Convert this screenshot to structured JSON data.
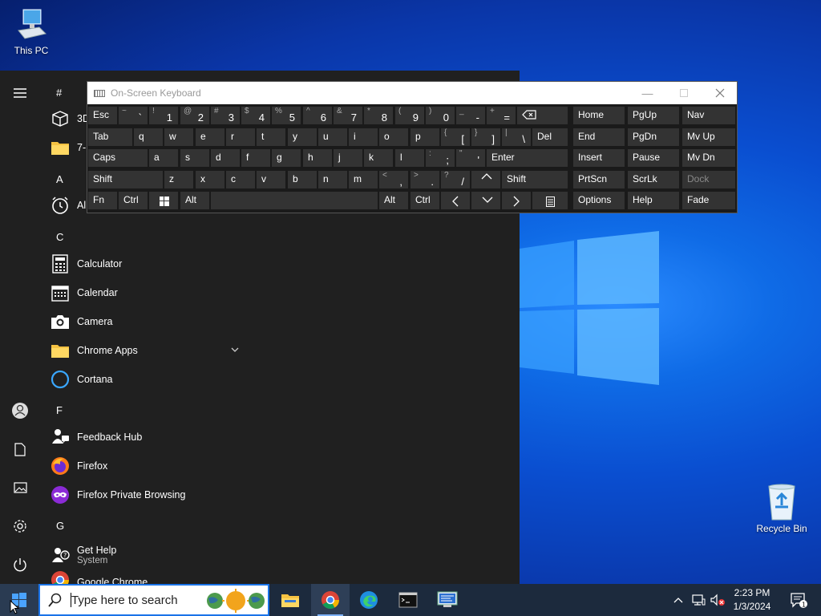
{
  "desktop": {
    "icons": [
      {
        "label": "This PC",
        "icon": "this-pc-icon"
      },
      {
        "label": "Recycle Bin",
        "icon": "recycle-bin-icon"
      }
    ]
  },
  "start_menu": {
    "rail": [
      "hamburger-icon",
      "user-icon",
      "documents-icon",
      "pictures-icon",
      "settings-icon",
      "power-icon"
    ],
    "letters": {
      "hash": "#",
      "a": "A",
      "c": "C",
      "f": "F",
      "g": "G"
    },
    "apps": {
      "3d": "3D",
      "sevenzip": "7-",
      "alarms": "Al",
      "calculator": "Calculator",
      "calendar": "Calendar",
      "camera": "Camera",
      "chrome_apps": "Chrome Apps",
      "cortana": "Cortana",
      "feedback_hub": "Feedback Hub",
      "firefox": "Firefox",
      "firefox_private": "Firefox Private Browsing",
      "get_help": "Get Help",
      "get_help_sub": "System",
      "google_chrome": "Google Chrome"
    }
  },
  "osk": {
    "title": "On-Screen Keyboard",
    "row1": [
      {
        "main": "Esc"
      },
      {
        "shift": "~",
        "low": "`",
        "sh2": "`"
      },
      {
        "shift": "!",
        "low": "1"
      },
      {
        "shift": "@",
        "low": "2"
      },
      {
        "shift": "#",
        "low": "3"
      },
      {
        "shift": "$",
        "low": "4"
      },
      {
        "shift": "%",
        "low": "5"
      },
      {
        "shift": "^",
        "low": "6"
      },
      {
        "shift": "&",
        "low": "7"
      },
      {
        "shift": "*",
        "low": "8"
      },
      {
        "shift": "(",
        "low": "9"
      },
      {
        "shift": ")",
        "low": "0"
      },
      {
        "shift": "_",
        "low": "-"
      },
      {
        "shift": "+",
        "low": "="
      },
      {
        "main": "⌫"
      }
    ],
    "row2": [
      {
        "main": "Tab"
      },
      {
        "main": "q"
      },
      {
        "main": "w"
      },
      {
        "main": "e"
      },
      {
        "main": "r"
      },
      {
        "main": "t"
      },
      {
        "main": "y"
      },
      {
        "main": "u"
      },
      {
        "main": "i"
      },
      {
        "main": "o"
      },
      {
        "main": "p"
      },
      {
        "shift": "{",
        "low": "["
      },
      {
        "shift": "}",
        "low": "]"
      },
      {
        "shift": "|",
        "low": "\\"
      },
      {
        "main": "Del"
      }
    ],
    "row3": [
      {
        "main": "Caps"
      },
      {
        "main": "a"
      },
      {
        "main": "s"
      },
      {
        "main": "d"
      },
      {
        "main": "f"
      },
      {
        "main": "g"
      },
      {
        "main": "h"
      },
      {
        "main": "j"
      },
      {
        "main": "k"
      },
      {
        "main": "l"
      },
      {
        "shift": ":",
        "low": ";"
      },
      {
        "shift": "\"",
        "low": "'"
      },
      {
        "main": "Enter"
      }
    ],
    "row4": [
      {
        "main": "Shift"
      },
      {
        "main": "z"
      },
      {
        "main": "x"
      },
      {
        "main": "c"
      },
      {
        "main": "v"
      },
      {
        "main": "b"
      },
      {
        "main": "n"
      },
      {
        "main": "m"
      },
      {
        "shift": "<",
        "low": ","
      },
      {
        "shift": ">",
        "low": "."
      },
      {
        "shift": "?",
        "low": "/"
      },
      {
        "main": "^"
      },
      {
        "main": "Shift"
      }
    ],
    "row5": [
      {
        "main": "Fn"
      },
      {
        "main": "Ctrl"
      },
      {
        "main": "win"
      },
      {
        "main": "Alt"
      },
      {
        "main": ""
      },
      {
        "main": "Alt"
      },
      {
        "main": "Ctrl"
      },
      {
        "main": "<"
      },
      {
        "main": "v"
      },
      {
        "main": ">"
      },
      {
        "main": "menu"
      }
    ],
    "nav": [
      [
        "Home",
        "PgUp",
        "Nav"
      ],
      [
        "End",
        "PgDn",
        "Mv Up"
      ],
      [
        "Insert",
        "Pause",
        "Mv Dn"
      ],
      [
        "PrtScn",
        "ScrLk",
        "Dock"
      ],
      [
        "Options",
        "Help",
        "Fade"
      ]
    ]
  },
  "taskbar": {
    "search_placeholder": "Type here to search",
    "apps": [
      "file-explorer-icon",
      "chrome-icon",
      "edge-icon",
      "terminal-icon",
      "rdp-icon"
    ],
    "time": "2:23 PM",
    "date": "1/3/2024",
    "notification_count": "1"
  }
}
